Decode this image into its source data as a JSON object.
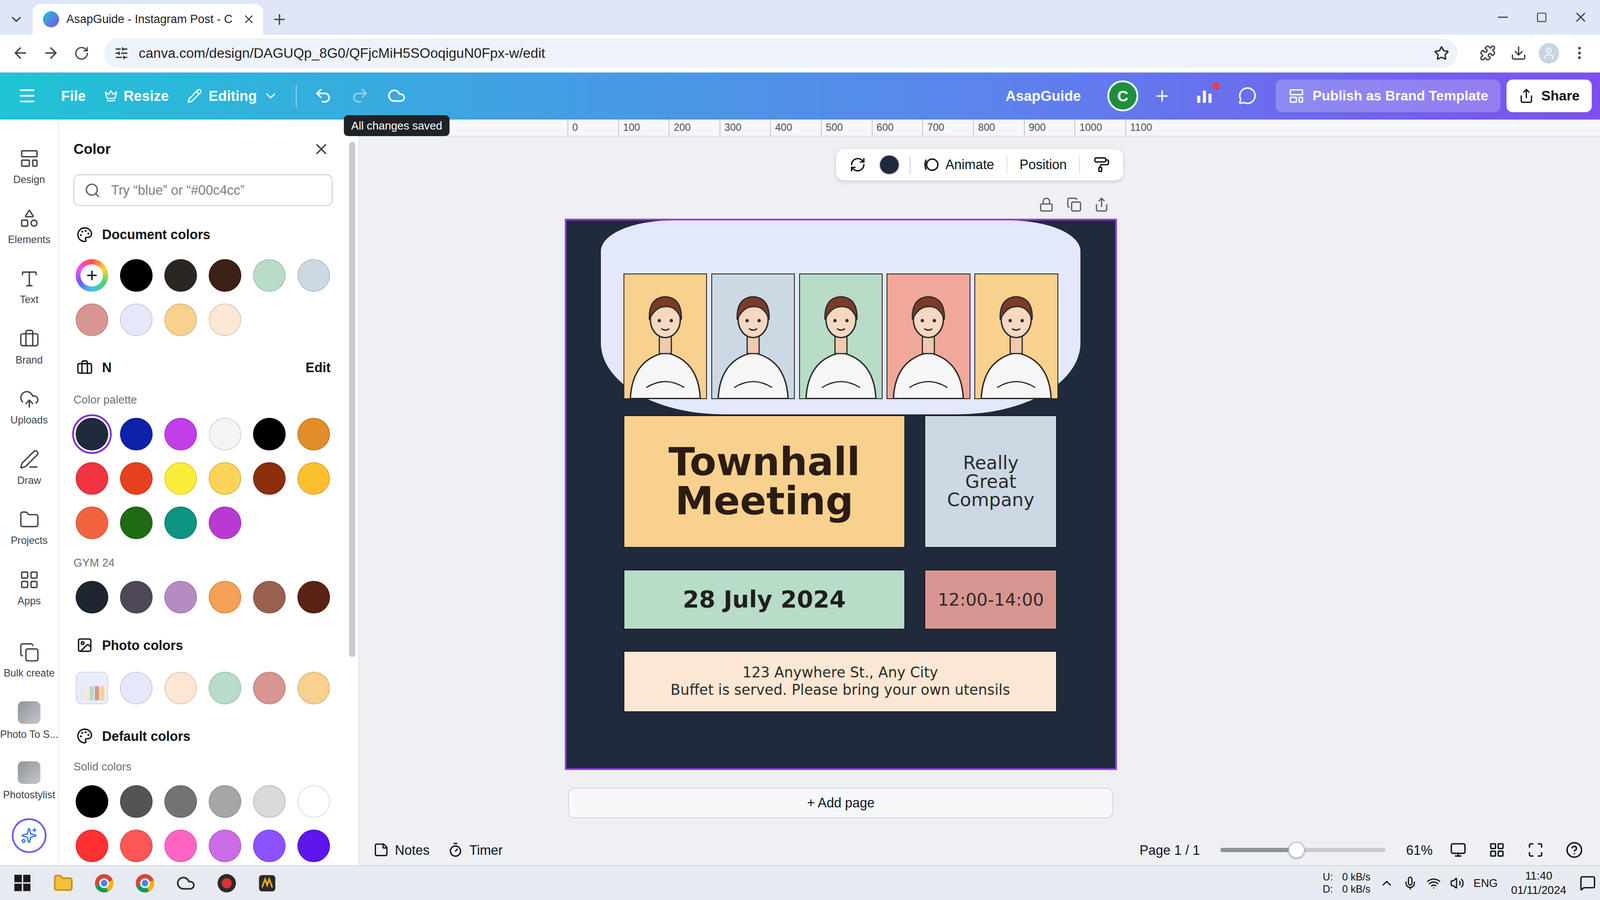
{
  "browser": {
    "tab": {
      "title": "AsapGuide - Instagram Post - C",
      "selected": true
    },
    "url": "canva.com/design/DAGUQp_8G0/QFjcMiH5SOoqiguN0Fpx-w/edit"
  },
  "header": {
    "menu": [
      "File",
      "Resize",
      "Editing"
    ],
    "undo": {
      "disabled": false
    },
    "redo": {
      "disabled": true
    },
    "tooltip": "All changes saved",
    "team": "AsapGuide",
    "avatar": "C",
    "notification": true,
    "publish": "Publish as Brand Template",
    "share": "Share"
  },
  "sidebar": {
    "items": [
      {
        "label": "Design",
        "kind": "tool"
      },
      {
        "label": "Elements",
        "kind": "tool"
      },
      {
        "label": "Text",
        "kind": "tool"
      },
      {
        "label": "Brand",
        "kind": "tool"
      },
      {
        "label": "Uploads",
        "kind": "tool"
      },
      {
        "label": "Draw",
        "kind": "tool"
      },
      {
        "label": "Projects",
        "kind": "tool"
      },
      {
        "label": "Apps",
        "kind": "tool"
      },
      {
        "label": "Bulk create",
        "kind": "tool"
      },
      {
        "label": "Photo To S...",
        "kind": "app"
      },
      {
        "label": "Photostylist",
        "kind": "app"
      }
    ]
  },
  "color_panel": {
    "title": "Color",
    "search": {
      "placeholder": "Try “blue” or “#00c4cc”"
    },
    "document_colors": {
      "title": "Document colors",
      "swatches": [
        {
          "color": "#000000",
          "selected": false
        },
        {
          "color": "#2a2622",
          "selected": false
        },
        {
          "color": "#3b2116",
          "selected": false
        },
        {
          "color": "#b8dcc8",
          "selected": false
        },
        {
          "color": "#ccd9e5",
          "selected": false
        },
        {
          "color": "#d99690",
          "selected": false
        },
        {
          "color": "#e3e8fb",
          "selected": false
        },
        {
          "color": "#f9d18e",
          "selected": false
        },
        {
          "color": "#fbe7d3",
          "selected": false
        }
      ]
    },
    "brand_kit": {
      "title": "N",
      "edit": "Edit",
      "palettes": [
        {
          "title": "Color palette",
          "swatches": [
            {
              "color": "#1f2a3c",
              "selected": true
            },
            {
              "color": "#0c22a8",
              "selected": false
            },
            {
              "color": "#c13ee8",
              "selected": false
            },
            {
              "color": "#f4f4f4",
              "selected": false
            },
            {
              "color": "#000000",
              "selected": false
            },
            {
              "color": "#e08e2a",
              "selected": false
            },
            {
              "color": "#ef3340",
              "selected": false
            },
            {
              "color": "#e8411f",
              "selected": false
            },
            {
              "color": "#fbee3a",
              "selected": false
            },
            {
              "color": "#fbd35a",
              "selected": false
            },
            {
              "color": "#8a2e0b",
              "selected": false
            },
            {
              "color": "#fdc02f",
              "selected": false
            },
            {
              "color": "#f26440",
              "selected": false
            },
            {
              "color": "#1e6b14",
              "selected": false
            },
            {
              "color": "#0d9480",
              "selected": false
            },
            {
              "color": "#b93ad2",
              "selected": false
            }
          ]
        },
        {
          "title": "GYM 24",
          "swatches": [
            {
              "color": "#1d252e",
              "selected": false
            },
            {
              "color": "#4e4858",
              "selected": false
            },
            {
              "color": "#b68bc4",
              "selected": false
            },
            {
              "color": "#f4a056",
              "selected": false
            },
            {
              "color": "#9a6150",
              "selected": false
            },
            {
              "color": "#5a2313",
              "selected": false
            }
          ]
        }
      ]
    },
    "photo_colors": {
      "title": "Photo colors",
      "swatches": [
        {
          "color": "#e3e8fb",
          "selected": false
        },
        {
          "color": "#fbe7d3",
          "selected": false
        },
        {
          "color": "#b8dcc8",
          "selected": false
        },
        {
          "color": "#d99690",
          "selected": false
        },
        {
          "color": "#f9d18e",
          "selected": false
        }
      ]
    },
    "default_colors": {
      "title": "Default colors",
      "groups": [
        {
          "title": "Solid colors",
          "swatches": [
            {
              "color": "#000000",
              "selected": false
            },
            {
              "color": "#545454",
              "selected": false
            },
            {
              "color": "#737373",
              "selected": false
            },
            {
              "color": "#a6a6a6",
              "selected": false
            },
            {
              "color": "#d9d9d9",
              "selected": false
            },
            {
              "color": "#ffffff",
              "selected": false
            },
            {
              "color": "#ff3131",
              "selected": false
            },
            {
              "color": "#ff5757",
              "selected": false
            },
            {
              "color": "#ff66c4",
              "selected": false
            },
            {
              "color": "#cb6ce6",
              "selected": false
            },
            {
              "color": "#8c52ff",
              "selected": false
            },
            {
              "color": "#5e17eb",
              "selected": false
            }
          ]
        }
      ]
    }
  },
  "canvas": {
    "ruler": [
      "0",
      "100",
      "200",
      "300",
      "400",
      "500",
      "600",
      "700",
      "800",
      "900",
      "1000",
      "1100"
    ],
    "element_toolbar": {
      "color": "#1f2a3c",
      "animate": "Animate",
      "position": "Position"
    },
    "design": {
      "selected": true,
      "background": "#1f2a3c",
      "people": [
        {
          "color": "#f9d18e"
        },
        {
          "color": "#ccd9e5"
        },
        {
          "color": "#b8dcc8"
        },
        {
          "color": "#f0a89a"
        },
        {
          "color": "#f9d18e"
        }
      ],
      "title": "Townhall Meeting",
      "company": "Really Great Company",
      "date": "28 July 2024",
      "time": "12:00-14:00",
      "address": [
        "123 Anywhere St., Any City",
        "Buffet is served. Please bring your own utensils"
      ]
    },
    "add_page": "+ Add page",
    "footer": {
      "notes": "Notes",
      "timer": "Timer",
      "page": "Page 1 / 1",
      "zoom": {
        "level": 0.46,
        "reading": "61%"
      }
    }
  },
  "taskbar": {
    "tray": {
      "upload_label": "U:",
      "download_label": "D:",
      "upload_rate": "0 kB/s",
      "download_rate": "0 kB/s",
      "language": "ENG",
      "time": "11:40",
      "date": "01/11/2024"
    }
  }
}
